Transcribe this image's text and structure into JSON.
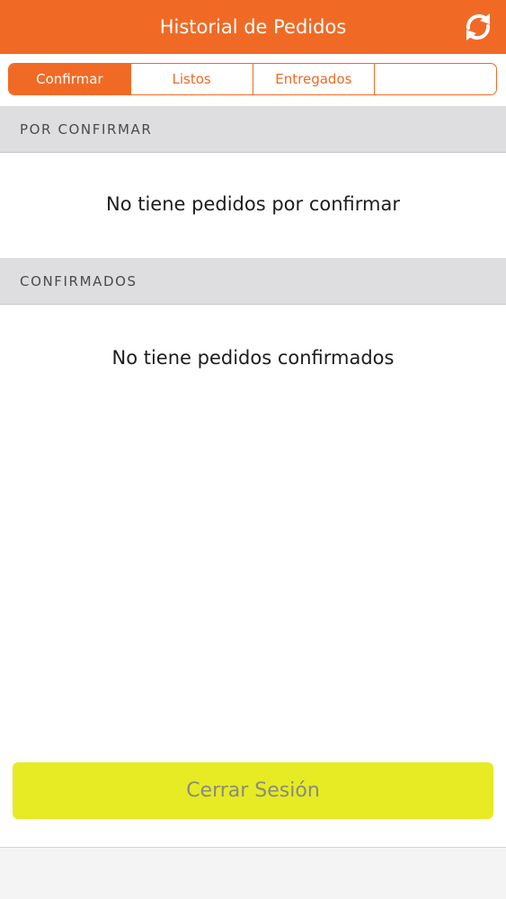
{
  "header": {
    "title": "Historial de Pedidos",
    "refresh_icon": "refresh-icon"
  },
  "tabs": [
    {
      "label": "Confirmar",
      "active": true
    },
    {
      "label": "Listos",
      "active": false
    },
    {
      "label": "Entregados",
      "active": false
    },
    {
      "label": "",
      "active": false
    }
  ],
  "sections": {
    "pending": {
      "title": "POR CONFIRMAR",
      "empty_message": "No tiene pedidos por confirmar"
    },
    "confirmed": {
      "title": "CONFIRMADOS",
      "empty_message": "No tiene pedidos confirmados"
    }
  },
  "logout_label": "Cerrar Sesión",
  "colors": {
    "accent": "#f06a25",
    "logout_bg": "#e6eb23",
    "section_bg": "#dedee0"
  }
}
